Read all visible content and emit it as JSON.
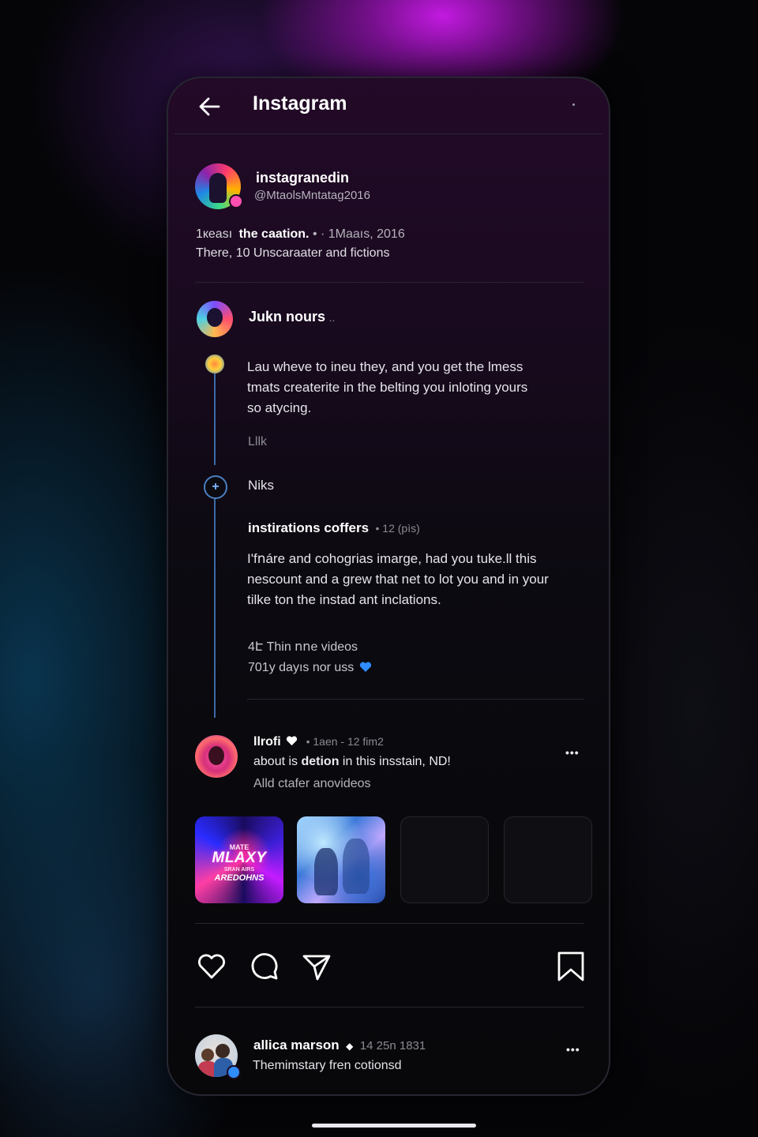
{
  "header": {
    "title": "Instagram"
  },
  "profile": {
    "name": "instagranedin",
    "handle": "@MtaolsMntatag2016",
    "meta_prefix": "1кeası",
    "meta_bold": "the caation.",
    "meta_suffix": "• · 1Maaıs, 2016",
    "desc": "There, 10 Unscaraater and fictions"
  },
  "thread": {
    "author": "Jukn nours",
    "author_suffix": "..",
    "body_lines": [
      "Lau wheve to ineu they, and you get the lmess",
      "tmats createrite in the belting you inloting yours",
      "so atycing."
    ],
    "like_label": "Lllk",
    "reply_label": "Niks",
    "reply_author": "instirations coffers",
    "reply_meta": "• 12 (рìs)",
    "reply_body_lines": [
      "I'fոáre and cohogrias imarge, had you tuke.ll this",
      "nescount and a grew that net to lot you and in your",
      "tilke ton the instad ant inclations."
    ],
    "stat1": "4Է Thin ոոe videos",
    "stat2": "701у dayıs nor uss"
  },
  "comment": {
    "author": "llrofi",
    "meta": "• 1aen - 12 fim2",
    "text_pre": "about is ",
    "text_bold": "detion",
    "text_post": " in this insstain, ND!",
    "sub": "Alld ctafer anovideos",
    "more": "•••"
  },
  "thumbs": {
    "t1_top": "MATE",
    "t1_main": "MLAXY",
    "t1_mid": "SRAN AIRS",
    "t1_bottom": "AREDOHNS"
  },
  "actions": {
    "icons": [
      "heart-icon",
      "comment-icon",
      "share-icon",
      "bookmark-icon"
    ]
  },
  "footer_post": {
    "author": "allica marson",
    "meta": "14 25n 1831",
    "text": "Themimstary fren cotionsd",
    "more": "•••"
  },
  "colors": {
    "accent_blue": "#3b6aa8",
    "heart_blue": "#2f8cff",
    "background": "#08080b"
  }
}
